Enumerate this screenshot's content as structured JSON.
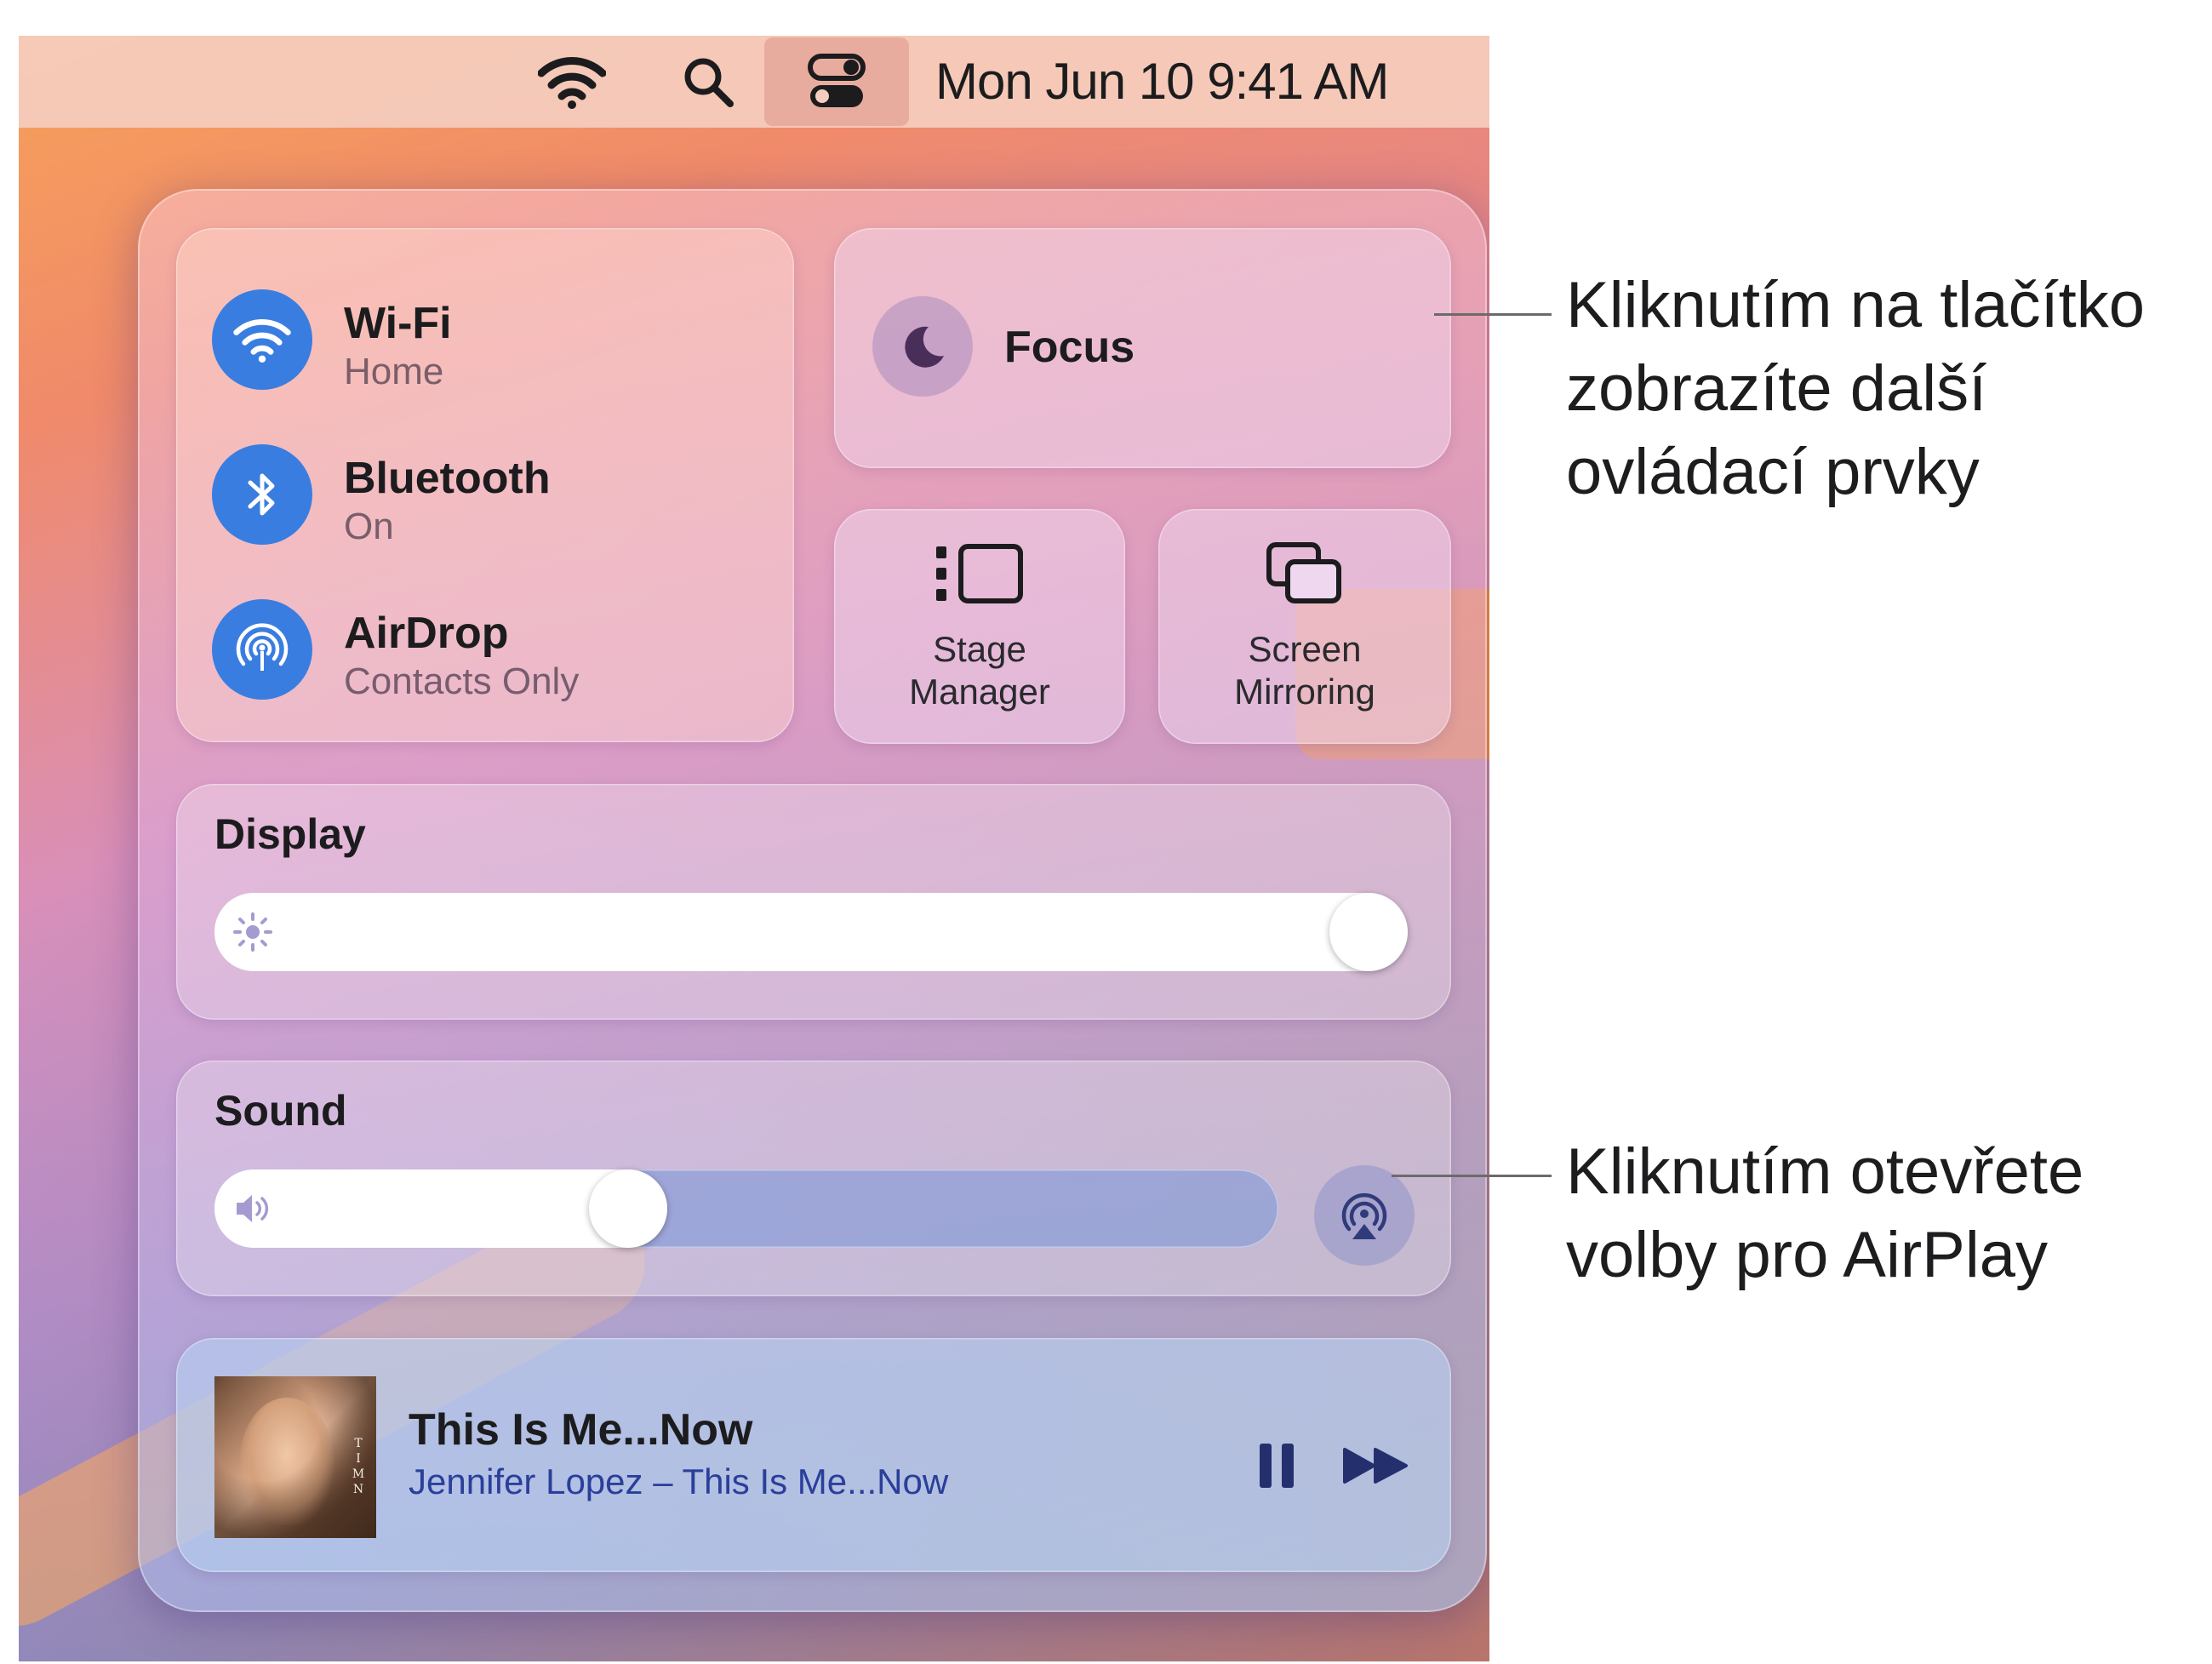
{
  "menubar": {
    "icons": [
      "wifi-icon",
      "search-icon",
      "control-center-icon"
    ],
    "datetime": "Mon Jun 10  9:41 AM"
  },
  "control_center": {
    "network": {
      "wifi": {
        "title": "Wi-Fi",
        "status": "Home",
        "icon": "wifi-icon"
      },
      "bluetooth": {
        "title": "Bluetooth",
        "status": "On",
        "icon": "bluetooth-icon"
      },
      "airdrop": {
        "title": "AirDrop",
        "status": "Contacts Only",
        "icon": "airdrop-icon"
      }
    },
    "focus": {
      "label": "Focus",
      "icon": "moon-icon"
    },
    "stage_manager": {
      "label": "Stage\nManager",
      "icon": "stage-manager-icon"
    },
    "screen_mirroring": {
      "label": "Screen\nMirroring",
      "icon": "screen-mirroring-icon"
    },
    "display": {
      "title": "Display",
      "brightness": 1.0,
      "icon": "sun-icon"
    },
    "sound": {
      "title": "Sound",
      "volume": 0.38,
      "icon": "speaker-icon",
      "airplay_icon": "airplay-icon"
    },
    "now_playing": {
      "title": "This Is Me...Now",
      "artist_album": "Jennifer Lopez – This Is Me...Now",
      "controls": [
        "pause-icon",
        "next-track-icon"
      ]
    }
  },
  "callouts": {
    "focus": "Kliknutím na tlačítko\nzobrazíte další\novládací prvky",
    "airplay": "Kliknutím otevřete\nvolby pro AirPlay"
  },
  "colors": {
    "accent_blue": "#3a7de0",
    "artist_text": "#2a3f9a"
  }
}
